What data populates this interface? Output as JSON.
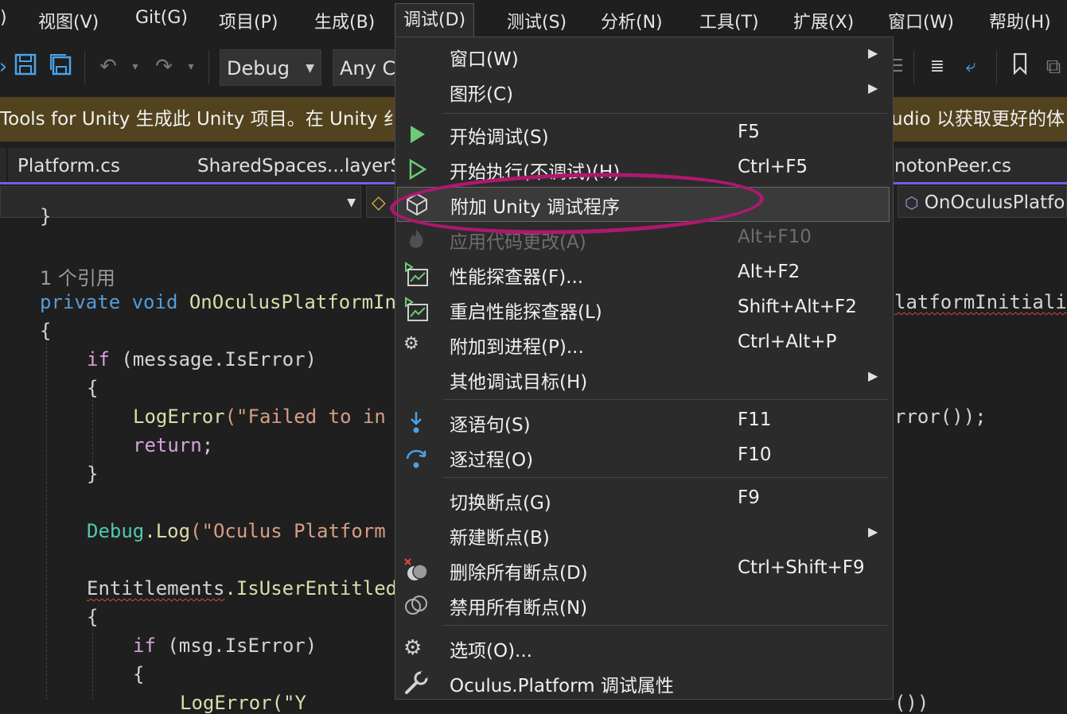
{
  "menubar": {
    "items": [
      "视图(V)",
      "Git(G)",
      "项目(P)",
      "生成(B)",
      "调试(D)",
      "测试(S)",
      "分析(N)",
      "工具(T)",
      "扩展(X)",
      "窗口(W)",
      "帮助(H)"
    ],
    "fragment": ")",
    "active_index": 4
  },
  "toolbar": {
    "config": "Debug",
    "platform": "Any C"
  },
  "infobar": {
    "text_left": "Tools for Unity 生成此 Unity 项目。在 Unity 纟",
    "text_right": "udio 以获取更好的体"
  },
  "tabs": [
    "Platform.cs",
    "SharedSpaces...layerS",
    "notonPeer.cs"
  ],
  "navbar": {
    "member": "OnOculusPlatfo"
  },
  "code": {
    "brace_close": "}",
    "ref_count": "1 个引用",
    "l1_kw1": "private",
    "l1_kw2": "void",
    "l1_method": "OnOculusPlatformIn",
    "l1_right": "latformInitiali",
    "open_brace": "{",
    "l2_if": "if",
    "l2_rest": " (message.IsError)",
    "l3_method": "LogError",
    "l3_str": "(\"Failed to in",
    "l3_right": "rror());",
    "l4_return": "return",
    "l4_semi": ";",
    "l5_type": "Debug",
    "l5_method": ".Log",
    "l5_str": "(\"Oculus Platform",
    "l6_type": "Entitlements",
    "l6_method": ".IsUserEntitled",
    "l7_if": "if",
    "l7_rest": " (msg.IsError)",
    "l8_partial": "LogError(\"Y",
    "l8_right": "())"
  },
  "debug_menu": {
    "items": [
      {
        "icon": "window-icon",
        "label": "窗口(W)",
        "shortcut": "",
        "submenu": true
      },
      {
        "icon": "graphics-icon",
        "label": "图形(C)",
        "shortcut": "",
        "submenu": true
      },
      {
        "icon": "start-debugging-icon",
        "label": "开始调试(S)",
        "shortcut": "F5",
        "submenu": false
      },
      {
        "icon": "start-without-debugging-icon",
        "label": "开始执行(不调试)(H)",
        "shortcut": "Ctrl+F5",
        "submenu": false
      },
      {
        "icon": "unity-icon",
        "label": "附加 Unity 调试程序",
        "shortcut": "",
        "submenu": false
      },
      {
        "icon": "hot-reload-icon",
        "label": "应用代码更改(A)",
        "shortcut": "Alt+F10",
        "submenu": false
      },
      {
        "icon": "performance-profiler-icon",
        "label": "性能探查器(F)...",
        "shortcut": "Alt+F2",
        "submenu": false
      },
      {
        "icon": "relaunch-profiler-icon",
        "label": "重启性能探查器(L)",
        "shortcut": "Shift+Alt+F2",
        "submenu": false
      },
      {
        "icon": "attach-process-icon",
        "label": "附加到进程(P)...",
        "shortcut": "Ctrl+Alt+P",
        "submenu": false
      },
      {
        "icon": "",
        "label": "其他调试目标(H)",
        "shortcut": "",
        "submenu": true
      },
      {
        "icon": "step-into-icon",
        "label": "逐语句(S)",
        "shortcut": "F11",
        "submenu": false
      },
      {
        "icon": "step-over-icon",
        "label": "逐过程(O)",
        "shortcut": "F10",
        "submenu": false
      },
      {
        "icon": "",
        "label": "切换断点(G)",
        "shortcut": "F9",
        "submenu": false
      },
      {
        "icon": "",
        "label": "新建断点(B)",
        "shortcut": "",
        "submenu": true
      },
      {
        "icon": "delete-breakpoints-icon",
        "label": "删除所有断点(D)",
        "shortcut": "Ctrl+Shift+F9",
        "submenu": false
      },
      {
        "icon": "disable-breakpoints-icon",
        "label": "禁用所有断点(N)",
        "shortcut": "",
        "submenu": false
      },
      {
        "icon": "gear-icon",
        "label": "选项(O)...",
        "shortcut": "",
        "submenu": false
      },
      {
        "icon": "wrench-icon",
        "label": "Oculus.Platform 调试属性",
        "shortcut": "",
        "submenu": false
      }
    ],
    "highlighted_index": 4,
    "disabled_index": 5
  },
  "colors": {
    "accent": "#7160e8",
    "annotation": "#b0176f",
    "play_green": "#6bcb77",
    "icon_blue": "#4aa3e8"
  }
}
